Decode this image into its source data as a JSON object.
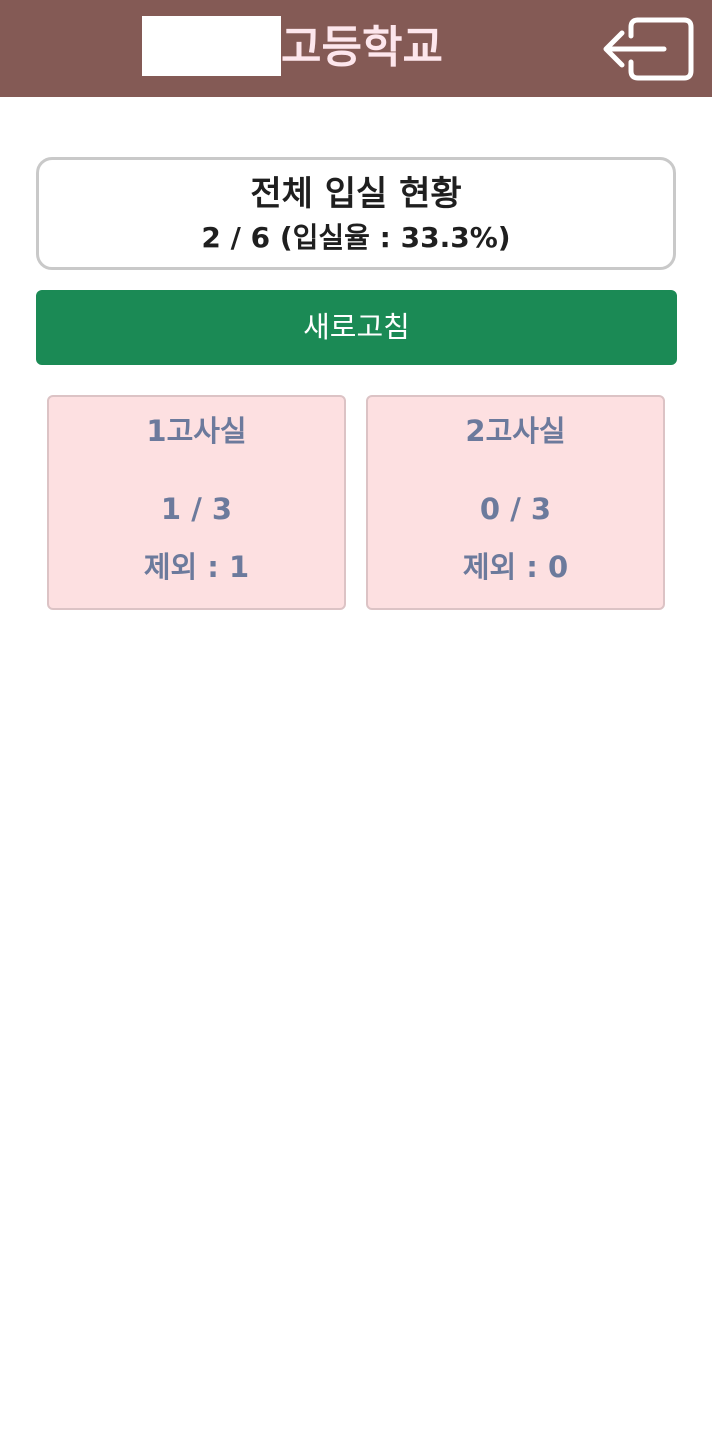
{
  "header": {
    "school_name": "고등학교",
    "logout_icon": "logout-icon"
  },
  "summary": {
    "title": "전체 입실 현황",
    "stats": "2 / 6 (입실율 : 33.3%)"
  },
  "refresh": {
    "label": "새로고침"
  },
  "rooms": [
    {
      "name": "1고사실",
      "count": "1 / 3",
      "excluded": "제외 : 1"
    },
    {
      "name": "2고사실",
      "count": "0 / 3",
      "excluded": "제외 : 0"
    }
  ],
  "colors": {
    "header_bg": "#845a55",
    "header_text": "#fde6ec",
    "refresh_bg": "#1b8a55",
    "room_bg": "#fde0e1",
    "room_text": "#6c7a9c"
  }
}
